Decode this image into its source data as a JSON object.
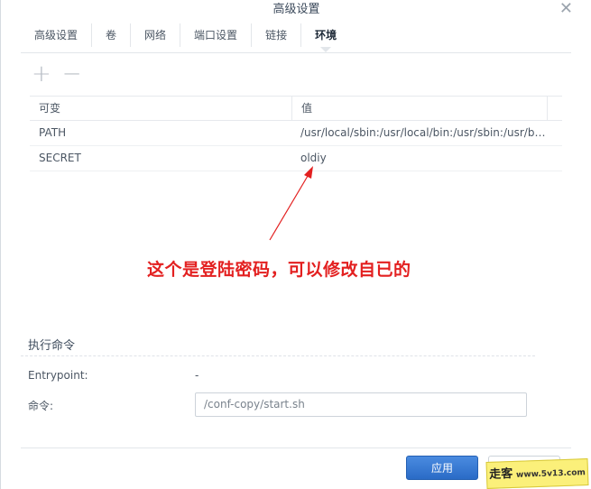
{
  "window": {
    "title": "高级设置"
  },
  "tabs": [
    "高级设置",
    "卷",
    "网络",
    "端口设置",
    "链接",
    "环境"
  ],
  "active_tab": "环境",
  "toolbar": {
    "add_icon": "plus-icon",
    "remove_icon": "minus-icon"
  },
  "table": {
    "headers": {
      "variable": "可变",
      "value": "值"
    },
    "rows": [
      {
        "variable": "PATH",
        "value": "/usr/local/sbin:/usr/local/bin:/usr/sbin:/usr/bin:/sbin:/bin"
      },
      {
        "variable": "SECRET",
        "value": "oldiy"
      }
    ]
  },
  "annotation": {
    "text": "这个是登陆密码，可以修改自已的",
    "color": "#e32020"
  },
  "exec": {
    "section_title": "执行命令",
    "entrypoint_label": "Entrypoint:",
    "entrypoint_value": "-",
    "command_label": "命令:",
    "command_value": "/conf-copy/start.sh"
  },
  "footer": {
    "apply_label": "应用"
  },
  "watermark": {
    "text_cn": "走客",
    "text_domain": "www.5v13.com"
  },
  "colors": {
    "accent": "#2a6bc6",
    "annotation": "#e32020"
  }
}
